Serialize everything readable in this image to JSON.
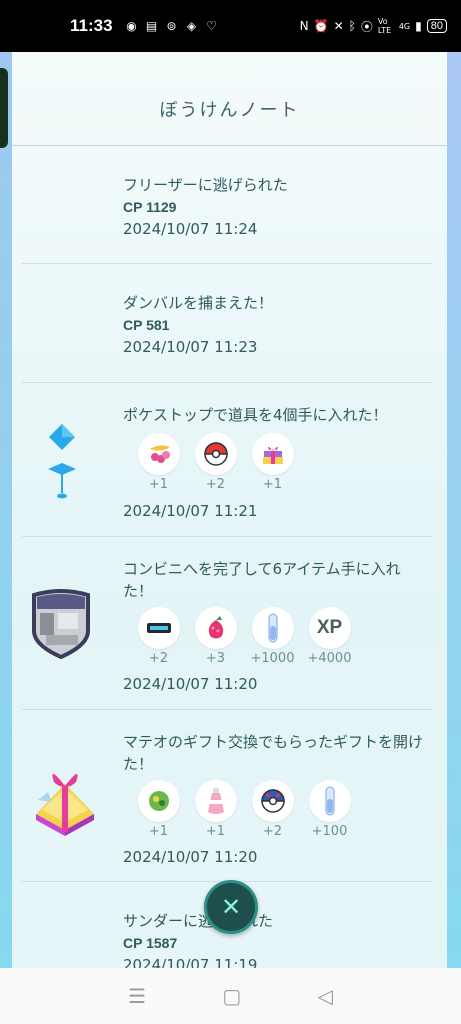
{
  "status_bar": {
    "time": "11:33",
    "network": "Vo LTE",
    "signal_type": "4G",
    "battery": "80"
  },
  "journal": {
    "title": "ぼうけんノート",
    "entries": [
      {
        "text": "フリーザーに逃げられた",
        "cp": "CP 1129",
        "date": "2024/10/07 11:24"
      },
      {
        "text": "ダンバルを捕まえた！",
        "cp": "CP 581",
        "date": "2024/10/07 11:23"
      },
      {
        "text": "ポケストップで道具を4個手に入れた！",
        "items": [
          {
            "icon": "razz-berry-bundle-icon",
            "qty": "+1"
          },
          {
            "icon": "poke-ball-icon",
            "qty": "+2"
          },
          {
            "icon": "gift-icon",
            "qty": "+1"
          }
        ],
        "date": "2024/10/07 11:21"
      },
      {
        "text": "コンビニへを完了して6アイテム手に入れた！",
        "items": [
          {
            "icon": "dark-item-icon",
            "qty": "+2"
          },
          {
            "icon": "razz-berry-icon",
            "qty": "+3"
          },
          {
            "icon": "stardust-vial-icon",
            "qty": "+1000"
          },
          {
            "icon": "xp-icon",
            "label": "XP",
            "qty": "+4000"
          }
        ],
        "date": "2024/10/07 11:20"
      },
      {
        "text": "マテオのギフト交換でもらったギフトを開けた！",
        "items": [
          {
            "icon": "postcard-icon",
            "qty": "+1"
          },
          {
            "icon": "potion-icon",
            "qty": "+1"
          },
          {
            "icon": "great-ball-icon",
            "qty": "+2"
          },
          {
            "icon": "stardust-vial-icon",
            "qty": "+100"
          }
        ],
        "date": "2024/10/07 11:20"
      },
      {
        "text": "サンダーに逃げられた",
        "cp": "CP 1587",
        "date": "2024/10/07 11:19"
      }
    ]
  },
  "colors": {
    "panel_text": "#2f5a5e",
    "close_button": "#1f4f4d",
    "close_accent": "#8ff0e2"
  }
}
